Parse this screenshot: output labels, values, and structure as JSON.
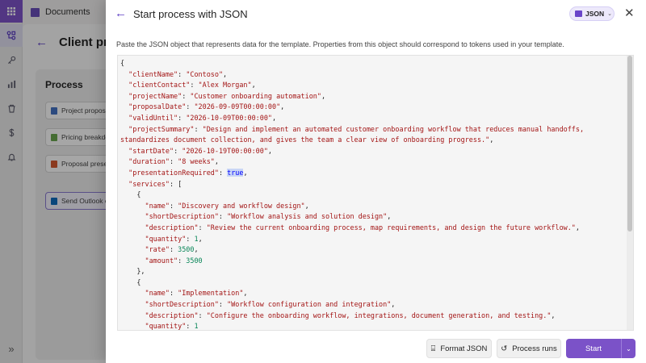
{
  "background": {
    "app_title": "Documents",
    "page_title": "Client pro",
    "process": {
      "title": "Process",
      "steps": [
        {
          "label": "Project proposal",
          "color": "#4472c4"
        },
        {
          "label": "Pricing breakdown",
          "color": "#6aa84f"
        },
        {
          "label": "Proposal presentation",
          "color": "#d65a31"
        },
        {
          "label": "Send Outlook email",
          "color": "#0f6cbd"
        }
      ],
      "add_symbol": "+"
    }
  },
  "rail": {
    "icons": [
      "apps-icon",
      "flow-icon",
      "key-icon",
      "chart-icon",
      "trash-icon",
      "dollar-icon",
      "bell-icon"
    ],
    "glyphs": [
      "⋮⋮",
      "⚇",
      "⚷",
      "▮▮",
      "🗑",
      "S",
      "🔔"
    ],
    "collapse": "»"
  },
  "panel": {
    "back_symbol": "←",
    "title": "Start process with JSON",
    "badge_label": "JSON",
    "badge_chevron": "⌄",
    "close_symbol": "✕",
    "description": "Paste the JSON object that represents data for the template. Properties from this object should correspond to tokens used in your template.",
    "json_lines": [
      [
        [
          "p",
          "{"
        ]
      ],
      [
        [
          "p",
          "  "
        ],
        [
          "k",
          "\"clientName\""
        ],
        [
          "p",
          ": "
        ],
        [
          "s",
          "\"Contoso\""
        ],
        [
          "p",
          ","
        ]
      ],
      [
        [
          "p",
          "  "
        ],
        [
          "k",
          "\"clientContact\""
        ],
        [
          "p",
          ": "
        ],
        [
          "s",
          "\"Alex Morgan\""
        ],
        [
          "p",
          ","
        ]
      ],
      [
        [
          "p",
          "  "
        ],
        [
          "k",
          "\"projectName\""
        ],
        [
          "p",
          ": "
        ],
        [
          "s",
          "\"Customer onboarding automation\""
        ],
        [
          "p",
          ","
        ]
      ],
      [
        [
          "p",
          "  "
        ],
        [
          "k",
          "\"proposalDate\""
        ],
        [
          "p",
          ": "
        ],
        [
          "s",
          "\"2026-09-09T00:00:00\""
        ],
        [
          "p",
          ","
        ]
      ],
      [
        [
          "p",
          "  "
        ],
        [
          "k",
          "\"validUntil\""
        ],
        [
          "p",
          ": "
        ],
        [
          "s",
          "\"2026-10-09T00:00:00\""
        ],
        [
          "p",
          ","
        ]
      ],
      [
        [
          "p",
          "  "
        ],
        [
          "k",
          "\"projectSummary\""
        ],
        [
          "p",
          ": "
        ],
        [
          "s",
          "\"Design and implement an automated customer onboarding workflow that reduces manual handoffs,"
        ]
      ],
      [
        [
          "s",
          "standardizes document collection, and gives the team a clear view of onboarding progress.\""
        ],
        [
          "p",
          ","
        ]
      ],
      [
        [
          "p",
          "  "
        ],
        [
          "k",
          "\"startDate\""
        ],
        [
          "p",
          ": "
        ],
        [
          "s",
          "\"2026-10-19T00:00:00\""
        ],
        [
          "p",
          ","
        ]
      ],
      [
        [
          "p",
          "  "
        ],
        [
          "k",
          "\"duration\""
        ],
        [
          "p",
          ": "
        ],
        [
          "s",
          "\"8 weeks\""
        ],
        [
          "p",
          ","
        ]
      ],
      [
        [
          "p",
          "  "
        ],
        [
          "k",
          "\"presentationRequired\""
        ],
        [
          "p",
          ": "
        ],
        [
          "b",
          "true"
        ],
        [
          "p",
          ","
        ]
      ],
      [
        [
          "p",
          "  "
        ],
        [
          "k",
          "\"services\""
        ],
        [
          "p",
          ": ["
        ]
      ],
      [
        [
          "p",
          "    {"
        ]
      ],
      [
        [
          "p",
          "      "
        ],
        [
          "k",
          "\"name\""
        ],
        [
          "p",
          ": "
        ],
        [
          "s",
          "\"Discovery and workflow design\""
        ],
        [
          "p",
          ","
        ]
      ],
      [
        [
          "p",
          "      "
        ],
        [
          "k",
          "\"shortDescription\""
        ],
        [
          "p",
          ": "
        ],
        [
          "s",
          "\"Workflow analysis and solution design\""
        ],
        [
          "p",
          ","
        ]
      ],
      [
        [
          "p",
          "      "
        ],
        [
          "k",
          "\"description\""
        ],
        [
          "p",
          ": "
        ],
        [
          "s",
          "\"Review the current onboarding process, map requirements, and design the future workflow.\""
        ],
        [
          "p",
          ","
        ]
      ],
      [
        [
          "p",
          "      "
        ],
        [
          "k",
          "\"quantity\""
        ],
        [
          "p",
          ": "
        ],
        [
          "n",
          "1"
        ],
        [
          "p",
          ","
        ]
      ],
      [
        [
          "p",
          "      "
        ],
        [
          "k",
          "\"rate\""
        ],
        [
          "p",
          ": "
        ],
        [
          "n",
          "3500"
        ],
        [
          "p",
          ","
        ]
      ],
      [
        [
          "p",
          "      "
        ],
        [
          "k",
          "\"amount\""
        ],
        [
          "p",
          ": "
        ],
        [
          "n",
          "3500"
        ]
      ],
      [
        [
          "p",
          "    },"
        ]
      ],
      [
        [
          "p",
          "    {"
        ]
      ],
      [
        [
          "p",
          "      "
        ],
        [
          "k",
          "\"name\""
        ],
        [
          "p",
          ": "
        ],
        [
          "s",
          "\"Implementation\""
        ],
        [
          "p",
          ","
        ]
      ],
      [
        [
          "p",
          "      "
        ],
        [
          "k",
          "\"shortDescription\""
        ],
        [
          "p",
          ": "
        ],
        [
          "s",
          "\"Workflow configuration and integration\""
        ],
        [
          "p",
          ","
        ]
      ],
      [
        [
          "p",
          "      "
        ],
        [
          "k",
          "\"description\""
        ],
        [
          "p",
          ": "
        ],
        [
          "s",
          "\"Configure the onboarding workflow, integrations, document generation, and testing.\""
        ],
        [
          "p",
          ","
        ]
      ],
      [
        [
          "p",
          "      "
        ],
        [
          "k",
          "\"quantity\""
        ],
        [
          "p",
          ": "
        ],
        [
          "n",
          "1"
        ]
      ]
    ],
    "footer": {
      "format_label": "Format JSON",
      "format_icon": "⌸",
      "runs_label": "Process runs",
      "runs_icon": "↺",
      "start_label": "Start",
      "split_icon": "⌄"
    },
    "accent_color": "#7b52c8"
  }
}
